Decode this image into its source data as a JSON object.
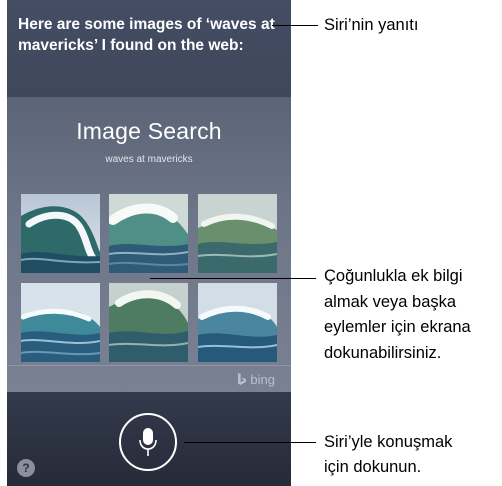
{
  "siri": {
    "response_text": "Here are some images of ‘waves at mavericks’ I found on the web:"
  },
  "card": {
    "title": "Image Search",
    "query": "waves at mavericks",
    "provider": "bing",
    "thumbnails": [
      {
        "icon": "wave-photo"
      },
      {
        "icon": "wave-photo"
      },
      {
        "icon": "wave-photo"
      },
      {
        "icon": "wave-photo"
      },
      {
        "icon": "wave-photo"
      },
      {
        "icon": "wave-photo"
      }
    ]
  },
  "controls": {
    "mic_icon": "microphone-icon",
    "help_label": "?"
  },
  "callouts": {
    "response": "Siri’nin yanıtı",
    "tap_screen_line1": "Çoğunlukla ek bilgi",
    "tap_screen_line2": "almak veya başka",
    "tap_screen_line3": "eylemler için ekrana",
    "tap_screen_line4": "dokunabilirsiniz.",
    "tap_to_speak_line1": "Siri’yle konuşmak",
    "tap_to_speak_line2": "için dokunun."
  },
  "colors": {
    "screen_background": "#3a4256",
    "card_background": "#6d7588",
    "bottom_bar": "#2c3242",
    "text_primary": "#ffffff"
  }
}
